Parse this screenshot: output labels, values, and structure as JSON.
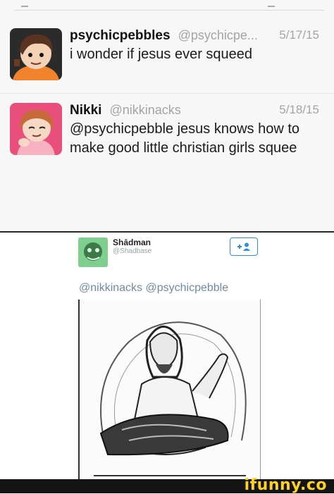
{
  "tweets": [
    {
      "name": "psychicpebbles",
      "handle": "@psychicpe...",
      "date": "5/17/15",
      "text": "i wonder if jesus ever squeed",
      "avatar_icon": "cartoon-boy-avatar-icon"
    },
    {
      "name": "Nikki",
      "handle": "@nikkinacks",
      "date": "5/18/15",
      "text": "@psychicpebble jesus knows how to make good little christian girls squee",
      "avatar_icon": "cartoon-girl-avatar-icon"
    }
  ],
  "reply": {
    "name": "Shādman",
    "handle": "@Shadbase",
    "mentions": "@nikkinacks @psychicpebble",
    "follow_icon": "follow-user-icon",
    "image_icon": "jesus-sketch-illustration-icon"
  },
  "watermark": {
    "text": "ifunny.co"
  },
  "colors": {
    "top_panel_bg": "#f7f7f7",
    "muted_text": "#a4a4a4",
    "link_blue": "#6f8aa3",
    "follow_blue": "#2f8fd8",
    "brand_yellow": "#ffd21f"
  }
}
